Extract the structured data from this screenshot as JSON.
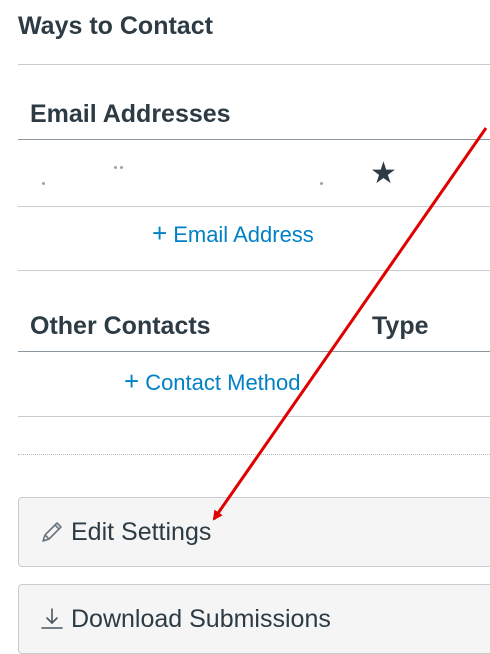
{
  "ways_to_contact": {
    "title": "Ways to Contact"
  },
  "email_addresses": {
    "heading": "Email Addresses",
    "add_label": "Email Address",
    "default_icon": "star-icon"
  },
  "other_contacts": {
    "heading": "Other Contacts",
    "type_heading": "Type",
    "add_label": "Contact Method"
  },
  "buttons": {
    "edit_settings": {
      "label": "Edit Settings",
      "icon": "pencil-icon"
    },
    "download_submissions": {
      "label": "Download Submissions",
      "icon": "download-icon"
    }
  },
  "colors": {
    "link": "#0081c6",
    "text": "#2d3b45",
    "annotation": "#e00000",
    "button_bg": "#f5f5f5",
    "border": "#c7cdd1"
  }
}
